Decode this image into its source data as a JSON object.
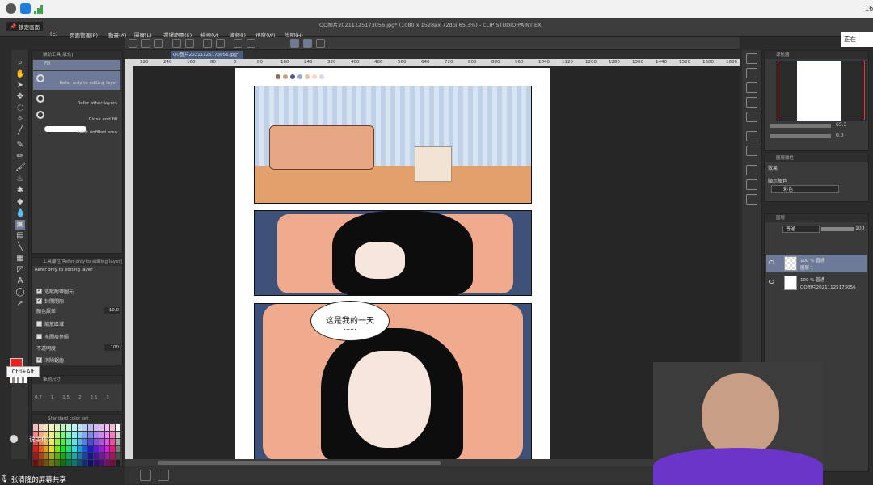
{
  "meeting_bar": {
    "clock_partial": "16",
    "status_right": "正在"
  },
  "window": {
    "title": "QQ图片20211125173056.jpg* (1080 x 1528px 72dpi 65.3%) - CLIP STUDIO PAINT EX",
    "lock_label": "锁定画面"
  },
  "menu": {
    "items": [
      {
        "label": "(E)"
      },
      {
        "label": "页面管理(P)"
      },
      {
        "label": "動畫(A)"
      },
      {
        "label": "圖層(L)"
      },
      {
        "label": "選擇範圍(S)"
      },
      {
        "label": "檢視(V)"
      },
      {
        "label": "濾鏡(I)"
      },
      {
        "label": "視窗(W)"
      },
      {
        "label": "說明(H)"
      }
    ]
  },
  "subtool_panel": {
    "header": "輔助工具[填充]",
    "items": [
      {
        "label": "Fill"
      },
      {
        "label": "Refer only to editing layer"
      },
      {
        "label": "Refer other layers"
      },
      {
        "label": "Close and fill"
      },
      {
        "label": "Paint unfilled area"
      }
    ]
  },
  "tool_property": {
    "header": "工具屬性[Refer only to editing layer]",
    "subtitle": "Refer only to editing layer",
    "rows": [
      {
        "label": "追蹤附帶圖元",
        "checked": true
      },
      {
        "label": "封閉間隙",
        "checked": true
      },
      {
        "label": "顏色誤差",
        "value": "10.0"
      },
      {
        "label": "縮放區域",
        "value": ""
      },
      {
        "label": "多圖層參照",
        "value": ""
      },
      {
        "label": "不透明度",
        "value": "100"
      },
      {
        "label": "消除鋸齒",
        "checked": true
      }
    ]
  },
  "brush_size_panel": {
    "header": "筆刷尺寸",
    "sizes": [
      "0.7",
      "1",
      "1.5",
      "2",
      "2.5",
      "3"
    ]
  },
  "color_set": {
    "header": "Standard color set"
  },
  "canvas": {
    "tab_label": "QQ图片20211125173056.jpg*",
    "ruler_ticks": [
      "320",
      "240",
      "160",
      "80",
      "0",
      "80",
      "160",
      "240",
      "320",
      "400",
      "480",
      "560",
      "640",
      "720",
      "800",
      "880",
      "960",
      "1040",
      "1120",
      "1200",
      "1280",
      "1360",
      "1440",
      "1520",
      "1600",
      "1680"
    ],
    "panels": [
      {
        "name": "bedroom-panel"
      },
      {
        "name": "sleeping-girl-panel"
      },
      {
        "name": "waking-girl-panel"
      }
    ],
    "bubble": {
      "line1": "这是我的一天",
      "line2": "......"
    }
  },
  "navigator": {
    "header": "導航器",
    "zoom": "65.3",
    "rotation": "0.0"
  },
  "layer_property": {
    "header": "圖層屬性",
    "effect_label": "效果",
    "display_color_label": "顯示顏色",
    "color_mode": "彩色"
  },
  "layers_panel": {
    "header": "圖層",
    "blend_mode": "普通",
    "opacity": "100",
    "layers": [
      {
        "line1": "100 % 普通",
        "line2": "圖層 1",
        "selected": true
      },
      {
        "line1": "100 % 普通",
        "line2": "QQ图片20211125173056",
        "selected": false
      }
    ]
  },
  "overlays": {
    "tooltip": "Ctrl+Alt",
    "chat_text": "说中什么",
    "share_banner": "张清隆的屏幕共享"
  },
  "colors": {
    "main_color": "#e8231f",
    "selection": "#6d7b99",
    "ui_panel": "#3a3a3a"
  }
}
